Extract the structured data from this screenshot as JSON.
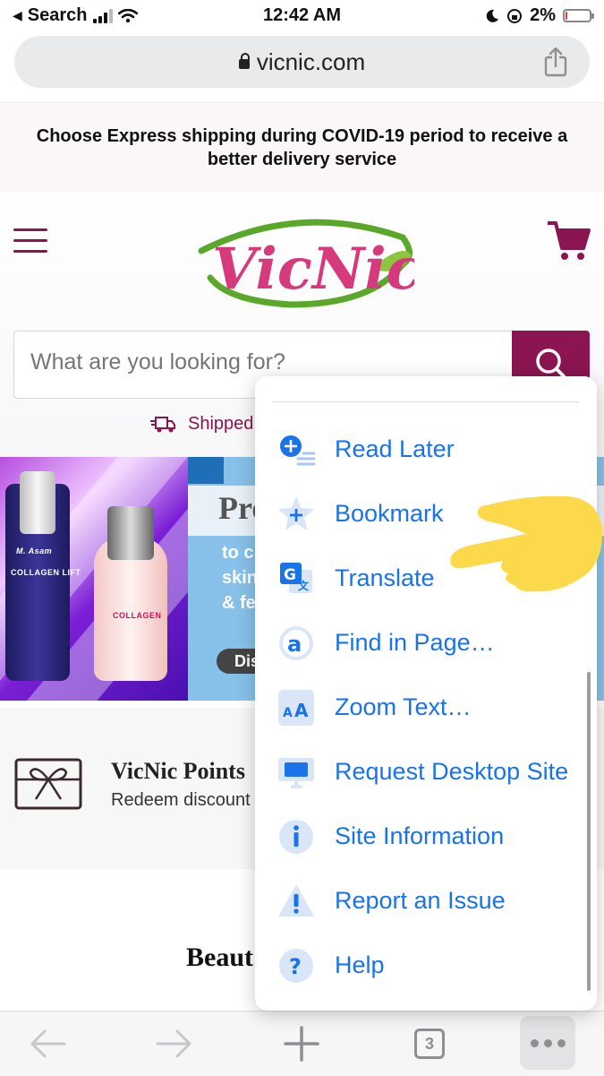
{
  "status_bar": {
    "back_app": "Search",
    "time": "12:42 AM",
    "battery": "2%",
    "battery_level": 0.02
  },
  "browser": {
    "url": "vicnic.com"
  },
  "site": {
    "shipping_notice": "Choose Express shipping during COVID-19 period to receive a better delivery service",
    "logo_text": "VicNic",
    "search_placeholder": "What are you looking for?",
    "shipped_text": "Shipped f",
    "promo": {
      "title": "Pro",
      "lines": [
        "to c",
        "skin",
        "& fe"
      ],
      "button": "Dis",
      "bottle_brand": "M. Asam",
      "bottle1_text": "COLLAGEN LIFT",
      "bottle2_text": "COLLAGEN"
    },
    "points_title": "VicNic Points",
    "points_subtitle": "Redeem discount w",
    "section_title": "Beaut"
  },
  "menu": {
    "items": [
      {
        "label": "Read Later",
        "icon": "read-later-icon"
      },
      {
        "label": "Bookmark",
        "icon": "bookmark-star-icon"
      },
      {
        "label": "Translate",
        "icon": "translate-icon"
      },
      {
        "label": "Find in Page…",
        "icon": "find-in-page-icon"
      },
      {
        "label": "Zoom Text…",
        "icon": "zoom-text-icon"
      },
      {
        "label": "Request Desktop Site",
        "icon": "desktop-icon"
      },
      {
        "label": "Site Information",
        "icon": "info-icon"
      },
      {
        "label": "Report an Issue",
        "icon": "warning-icon"
      },
      {
        "label": "Help",
        "icon": "help-icon"
      }
    ]
  },
  "toolbar": {
    "tab_count": "3"
  },
  "colors": {
    "brand": "#8a1550",
    "menu_text": "#1a73e8",
    "pointer": "#fcd94a"
  }
}
